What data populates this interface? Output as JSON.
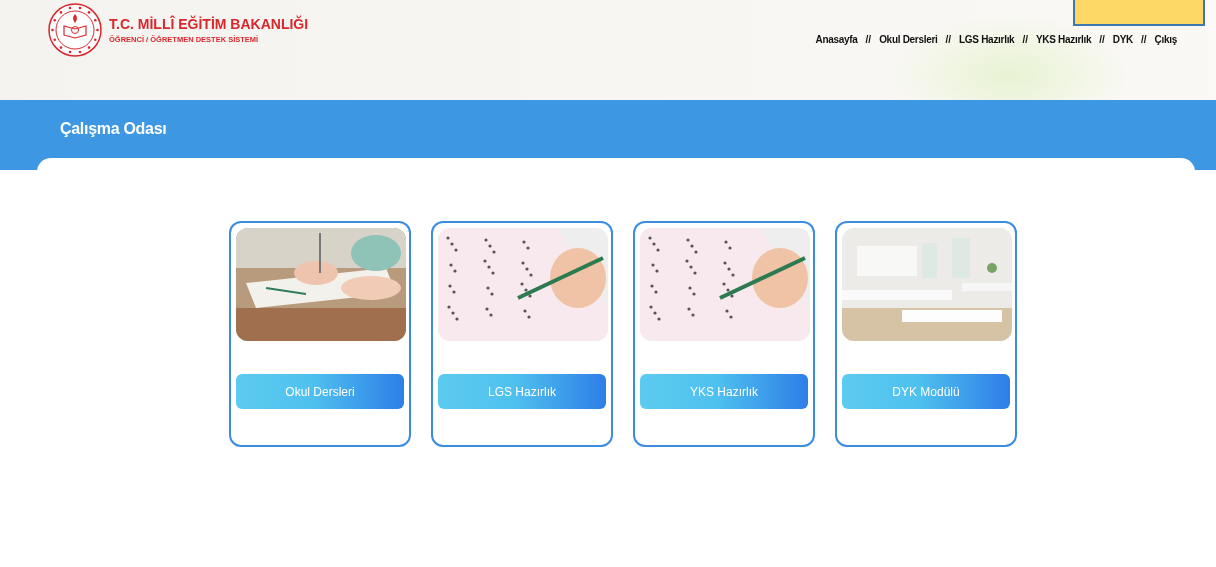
{
  "header": {
    "title": "T.C. MİLLÎ EĞİTİM BAKANLIĞI",
    "subtitle": "ÖĞRENCİ / ÖĞRETMEN DESTEK SİSTEMİ"
  },
  "nav": [
    {
      "kind": "link",
      "label": "Anasayfa"
    },
    {
      "kind": "separator",
      "label": "//"
    },
    {
      "kind": "link",
      "label": "Okul Dersleri"
    },
    {
      "kind": "separator",
      "label": "//"
    },
    {
      "kind": "link",
      "label": "LGS Hazırlık"
    },
    {
      "kind": "separator",
      "label": "//"
    },
    {
      "kind": "link",
      "label": "YKS Hazırlık"
    },
    {
      "kind": "separator",
      "label": "//"
    },
    {
      "kind": "link",
      "label": "DYK"
    },
    {
      "kind": "separator",
      "label": "//"
    },
    {
      "kind": "link",
      "label": "Çıkış"
    }
  ],
  "page_title": "Çalışma Odası",
  "cards": [
    {
      "button": "Okul Dersleri"
    },
    {
      "button": "LGS Hazırlık"
    },
    {
      "button": "YKS Hazırlık"
    },
    {
      "button": "DYK Modülü"
    }
  ]
}
